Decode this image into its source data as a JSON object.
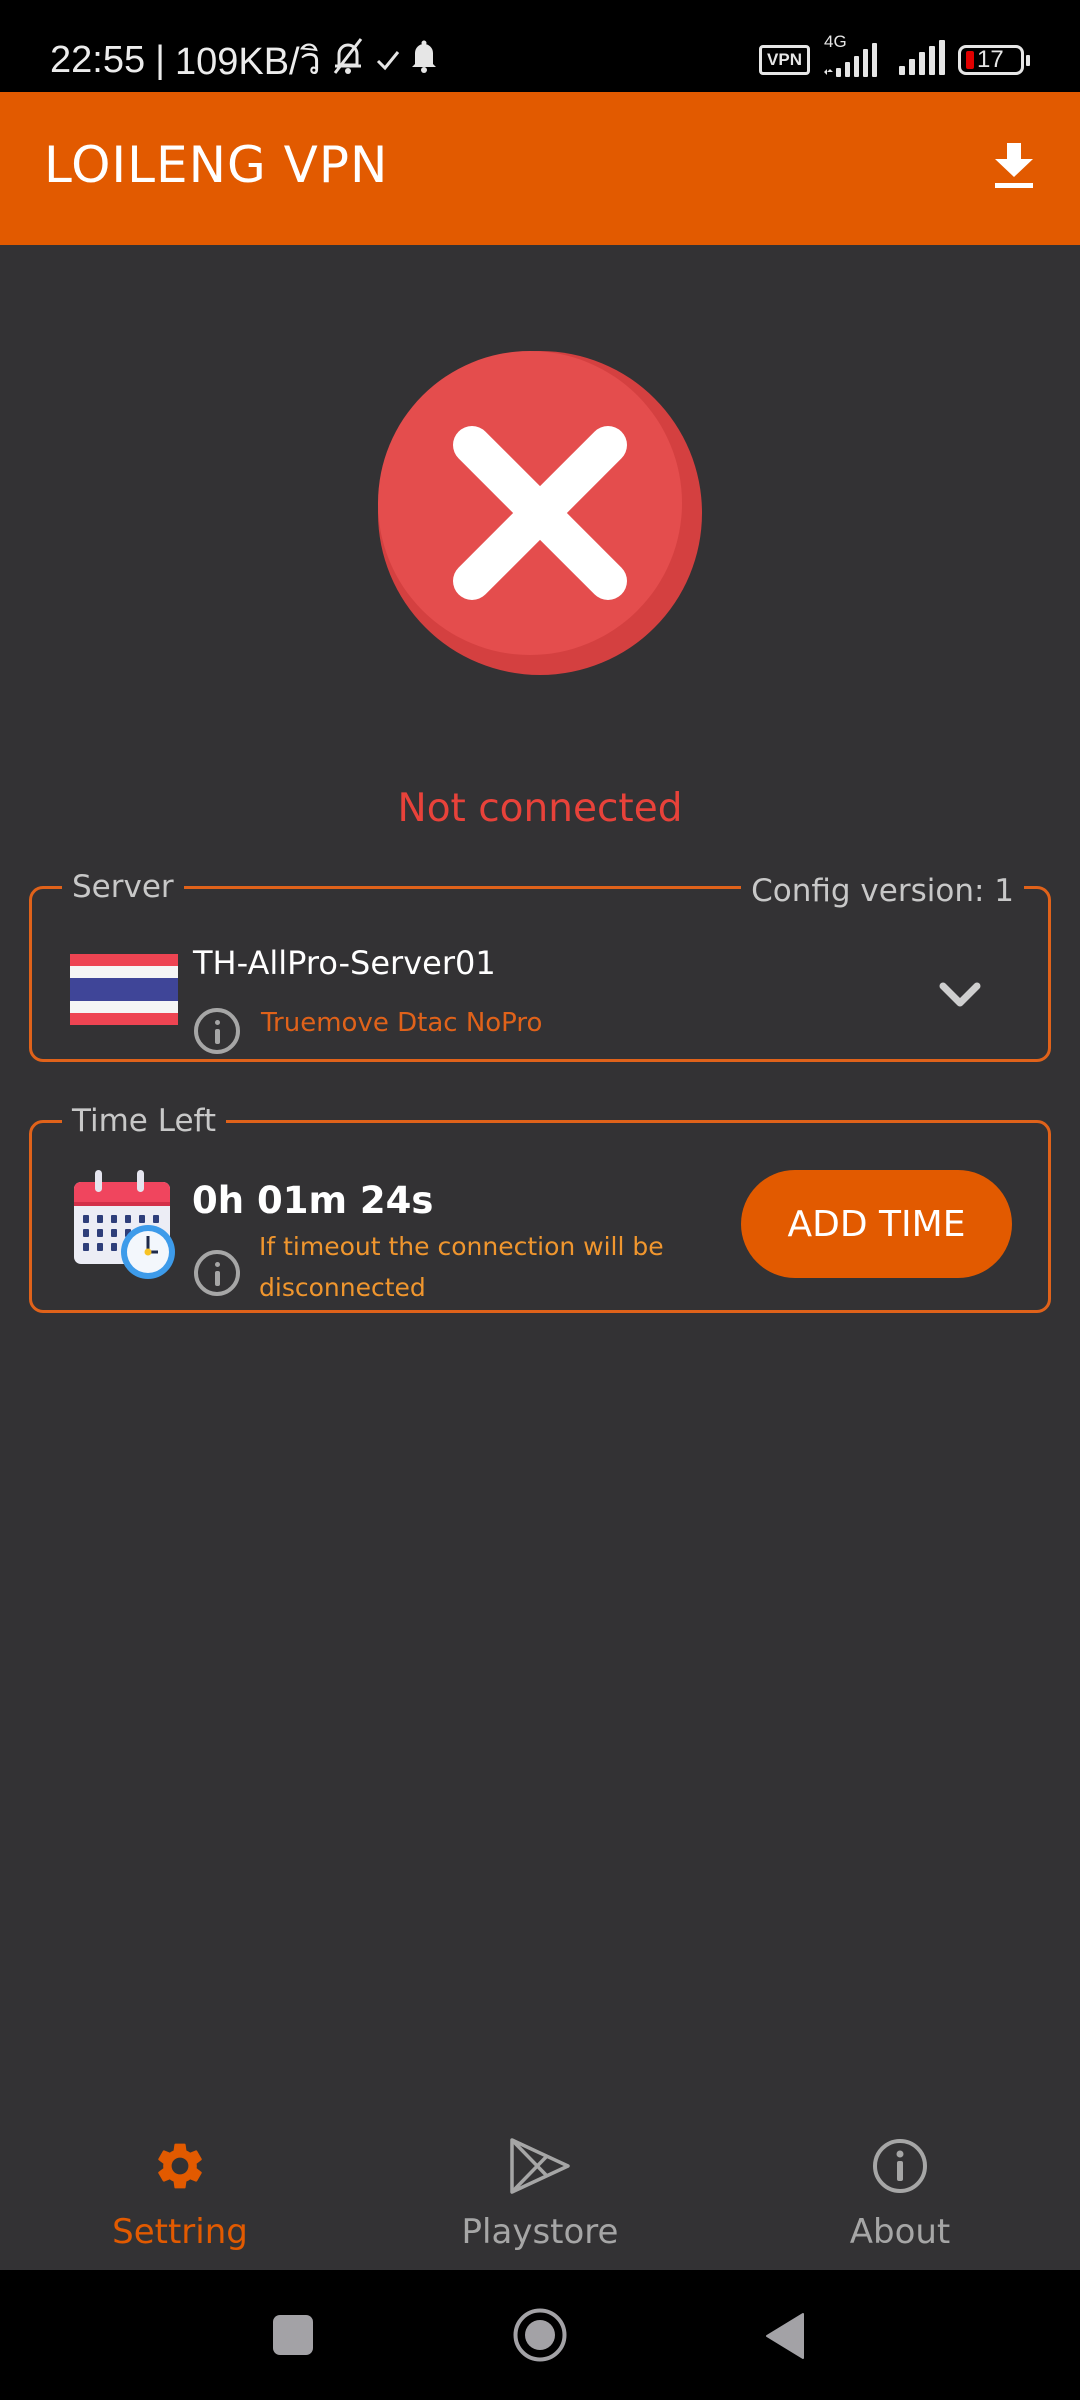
{
  "status_bar": {
    "time": "22:55",
    "separator": "|",
    "net_speed": "109KB/วิ",
    "icons": [
      "bell-off-icon",
      "check-icon",
      "bell-icon"
    ],
    "vpn_badge": "VPN",
    "network_type": "4G",
    "battery_percent": "17"
  },
  "app_bar": {
    "title": "LOILENG VPN",
    "download_icon": "download-icon"
  },
  "connection": {
    "status_icon": "error-x-icon",
    "status_text": "Not connected",
    "status_color": "#E8423A"
  },
  "server_card": {
    "legend": "Server",
    "config_version": "Config version: 1",
    "flag": "thailand-flag",
    "server_name": "TH-AllPro-Server01",
    "server_description": "Truemove Dtac NoPro"
  },
  "time_card": {
    "legend": "Time Left",
    "time_left": "0h 01m 24s",
    "message": "If timeout the connection will be disconnected",
    "add_time_label": "ADD TIME"
  },
  "bottom_nav": {
    "items": [
      {
        "label": "Settring",
        "icon": "gear-icon",
        "active": true
      },
      {
        "label": "Playstore",
        "icon": "play-store-icon",
        "active": false
      },
      {
        "label": "About",
        "icon": "info-icon",
        "active": false
      }
    ]
  },
  "colors": {
    "accent": "#E25A00",
    "border": "#E0621A",
    "background": "#333234",
    "error": "#E8423A",
    "hint": "#F0962E"
  }
}
